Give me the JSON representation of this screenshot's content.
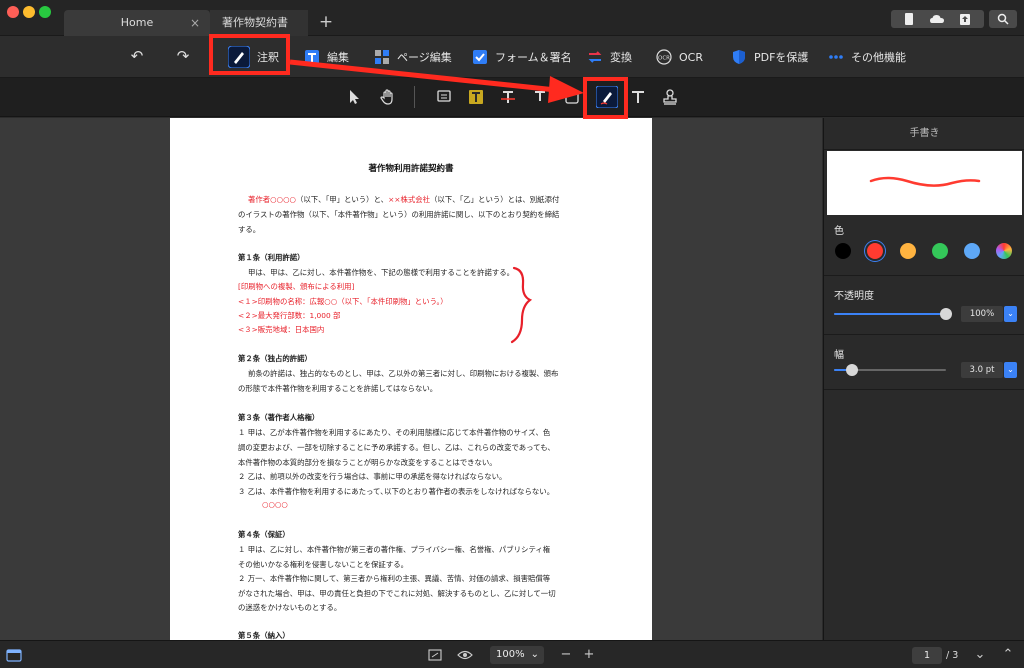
{
  "tabs": [
    {
      "label": "Home"
    },
    {
      "label": "著作物契約書"
    }
  ],
  "tab_close": "×",
  "tab_add": "+",
  "toolbar": {
    "annotate": "注釈",
    "edit": "編集",
    "page_edit": "ページ編集",
    "form_sign": "フォーム＆署名",
    "convert": "変換",
    "ocr": "OCR",
    "protect": "PDFを保護",
    "more": "その他機能"
  },
  "document": {
    "title": "著作物利用許諾契約書",
    "lines": [
      {
        "red_prefix": "著作者○○○○",
        "text1": "（以下、「甲」という）と、",
        "red_mid": "××株式会社",
        "text2": "（以下、「乙」という）とは、別紙添付"
      },
      "のイラストの著作物（以下、「本件著作物」という）の利用許諾に関し、以下のとおり契約を締結",
      "する。",
      "第１条（利用許諾）",
      "甲は、甲は、乙に対し、本件著作物を、下記の態様で利用することを許諾する。",
      "[印刷物への複製、頒布による利用]",
      "<１>印刷物の名称：広報○○（以下、「本件印刷物」という。）",
      "<２>最大発行部数：1,000 部",
      "<３>販売地域：日本国内",
      "第２条（独占的許諾）",
      "前条の許諾は、独占的なものとし、甲は、乙以外の第三者に対し、印刷物における複製、頒布",
      "の形態で本件著作物を利用することを許諾してはならない。",
      "第３条（著作者人格権）",
      "１ 甲は、乙が本件著作物を利用するにあたり、その利用態様に応じて本件著作物のサイズ、色",
      "調の変更および、一部を切除することに予め承諾する。但し、乙は、これらの改変であっても、",
      "本件著作物の本質的部分を損なうことが明らかな改変をすることはできない。",
      "２ 乙は、前項以外の改変を行う場合は、事前に甲の承諾を得なければならない。",
      "３ 乙は、本件著作物を利用するにあたって､以下のとおり著作者の表示をしなければならない。",
      "○○○○",
      "第４条（保証）",
      "１ 甲は、乙に対し、本件著作物が第三者の著作権、プライバシー権、名誉権、パブリシティ権",
      "その他いかなる権利を侵害しないことを保証する。",
      "２ 万一、本件著作物に関して、第三者から権利の主張、異議、苦情、対価の請求、損害賠償等",
      "がなされた場合、甲は、甲の責任と負担の下でこれに対処、解決するものとし、乙に対して一切",
      "の迷惑をかけないものとする。",
      "第５条（納入）"
    ]
  },
  "panel": {
    "header": "手書き",
    "color_label": "色",
    "opacity_label": "不透明度",
    "opacity_value": "100%",
    "width_label": "幅",
    "width_value": "3.0 pt",
    "colors": [
      "#000000",
      "#ff3b30",
      "#ffb340",
      "#34c759",
      "#5ea8f7",
      "rainbow"
    ],
    "selected_color": "#ff3b30",
    "opacity_level": 1.0,
    "width_level": 0.16
  },
  "status": {
    "zoom": "100%",
    "current_page": "1",
    "total_pages": "/ 3"
  },
  "colors": {
    "accent": "#3b82f6",
    "highlight": "#ff2a1f"
  }
}
